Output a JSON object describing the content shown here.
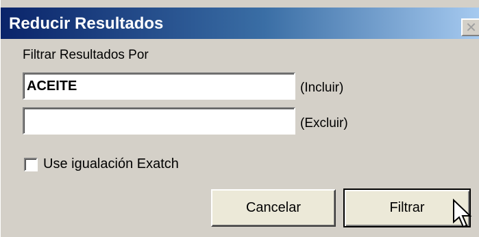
{
  "window": {
    "title": "Reducir Resultados",
    "close_glyph": "✕",
    "colors": {
      "title_bar_start": "#0a246a",
      "title_bar_end": "#a6caf0",
      "face": "#d4d0c8",
      "button_face": "#ece9d8"
    }
  },
  "filter": {
    "label": "Filtrar Resultados Por",
    "include": {
      "value": "ACEITE",
      "side_label": "(Incluir)"
    },
    "exclude": {
      "value": "",
      "side_label": "(Excluir)"
    }
  },
  "exact_match": {
    "label": "Use igualación Exatch",
    "checked": false
  },
  "buttons": {
    "cancel_label": "Cancelar",
    "filter_label": "Filtrar"
  },
  "cursor": {
    "icon": "arrow-pointer-icon"
  }
}
